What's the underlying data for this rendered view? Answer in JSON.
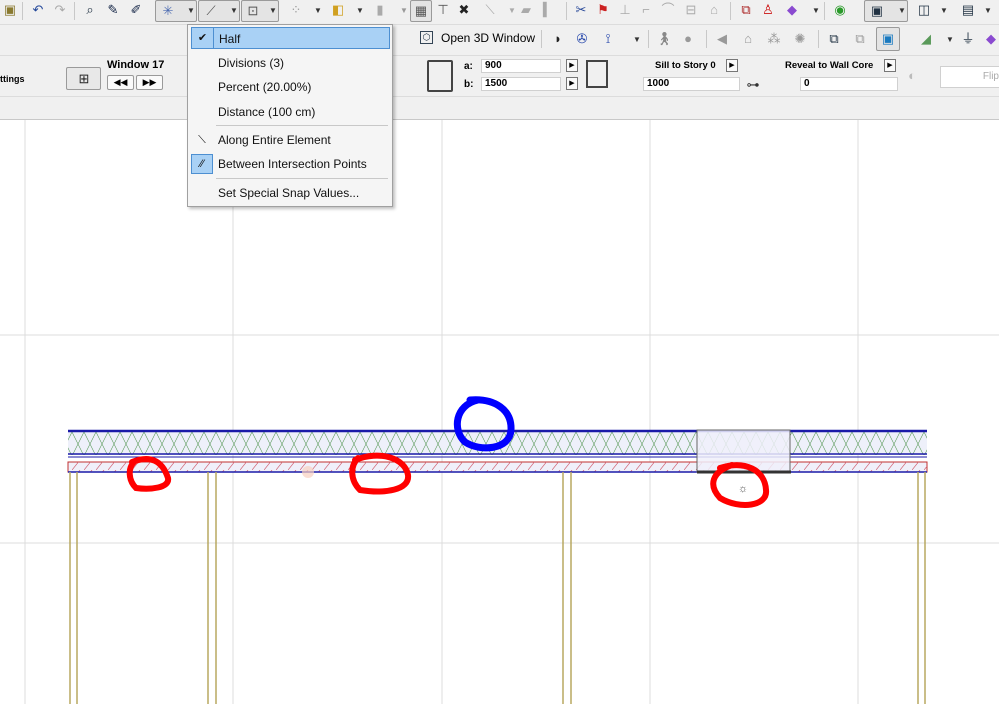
{
  "toolbar": {
    "open_3d_label": "Open 3D Window",
    "settings_label": "ttings",
    "element_title": "Window 17",
    "field_a_label": "a:",
    "field_a_value": "900",
    "field_b_label": "b:",
    "field_b_value": "1500",
    "sill_label": "Sill to Story 0",
    "sill_value": "1000",
    "reveal_label": "Reveal to Wall Core",
    "reveal_value": "0",
    "flip_label": "Flip"
  },
  "snap_menu": {
    "items": [
      {
        "label": "Half",
        "selected": true,
        "icon": "checkmark-icon"
      },
      {
        "label": "Divisions (3)"
      },
      {
        "label": "Percent (20.00%)"
      },
      {
        "label": "Distance (100 cm)"
      },
      {
        "label": "Along Entire Element",
        "icon": "along-element-icon"
      },
      {
        "label": "Between Intersection Points",
        "icon": "between-intersections-icon",
        "active": true
      },
      {
        "label": "Set Special Snap Values..."
      }
    ]
  },
  "colors": {
    "wall_outline": "#1a1aa8",
    "wall_hatch": "#5a9a5a",
    "finish_hatch": "#d06070",
    "post": "#b8a860",
    "annotation_red": "#ff0000",
    "annotation_blue": "#0000ff",
    "menu_highlight": "#a9d1f5"
  }
}
